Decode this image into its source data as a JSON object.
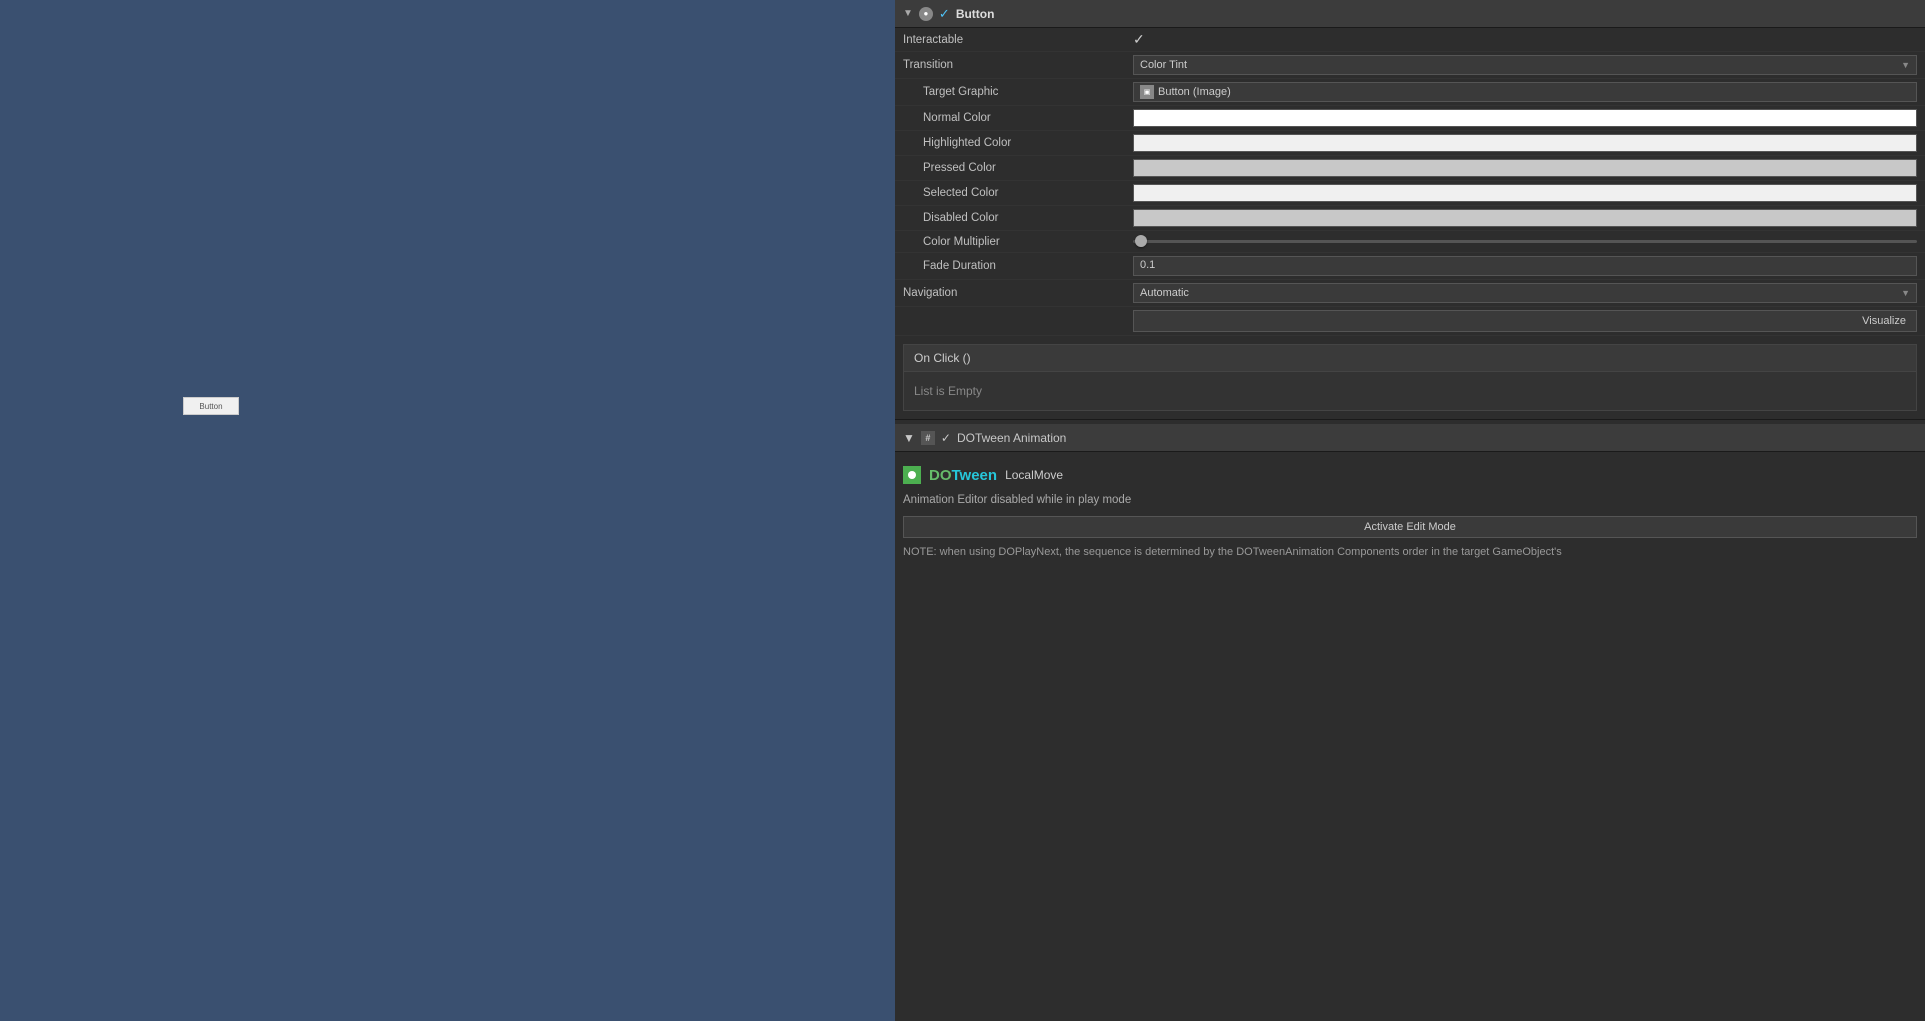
{
  "scene": {
    "button_label": "Button"
  },
  "inspector": {
    "button_section": {
      "title": "Button",
      "interactable_label": "Interactable",
      "interactable_checked": true,
      "transition_label": "Transition",
      "transition_value": "Color Tint",
      "target_graphic_label": "Target Graphic",
      "target_graphic_value": "Button (Image)",
      "normal_color_label": "Normal Color",
      "highlighted_color_label": "Highlighted Color",
      "pressed_color_label": "Pressed Color",
      "selected_color_label": "Selected Color",
      "disabled_color_label": "Disabled Color",
      "color_multiplier_label": "Color Multiplier",
      "fade_duration_label": "Fade Duration",
      "fade_duration_value": "0.1",
      "navigation_label": "Navigation",
      "navigation_value": "Automatic",
      "visualize_label": "Visualize",
      "onclick_label": "On Click ()",
      "list_empty_label": "List is Empty"
    },
    "dotween_section": {
      "title": "DOTween Animation",
      "logo_do": "DO",
      "logo_tween": "Tween",
      "local_move_label": "LocalMove",
      "disabled_message": "Animation Editor disabled while in play mode",
      "activate_btn_label": "Activate Edit Mode",
      "note_text": "NOTE: when using DOPlayNext, the sequence is determined by the DOTweenAnimation Components order in the target GameObject's"
    }
  }
}
